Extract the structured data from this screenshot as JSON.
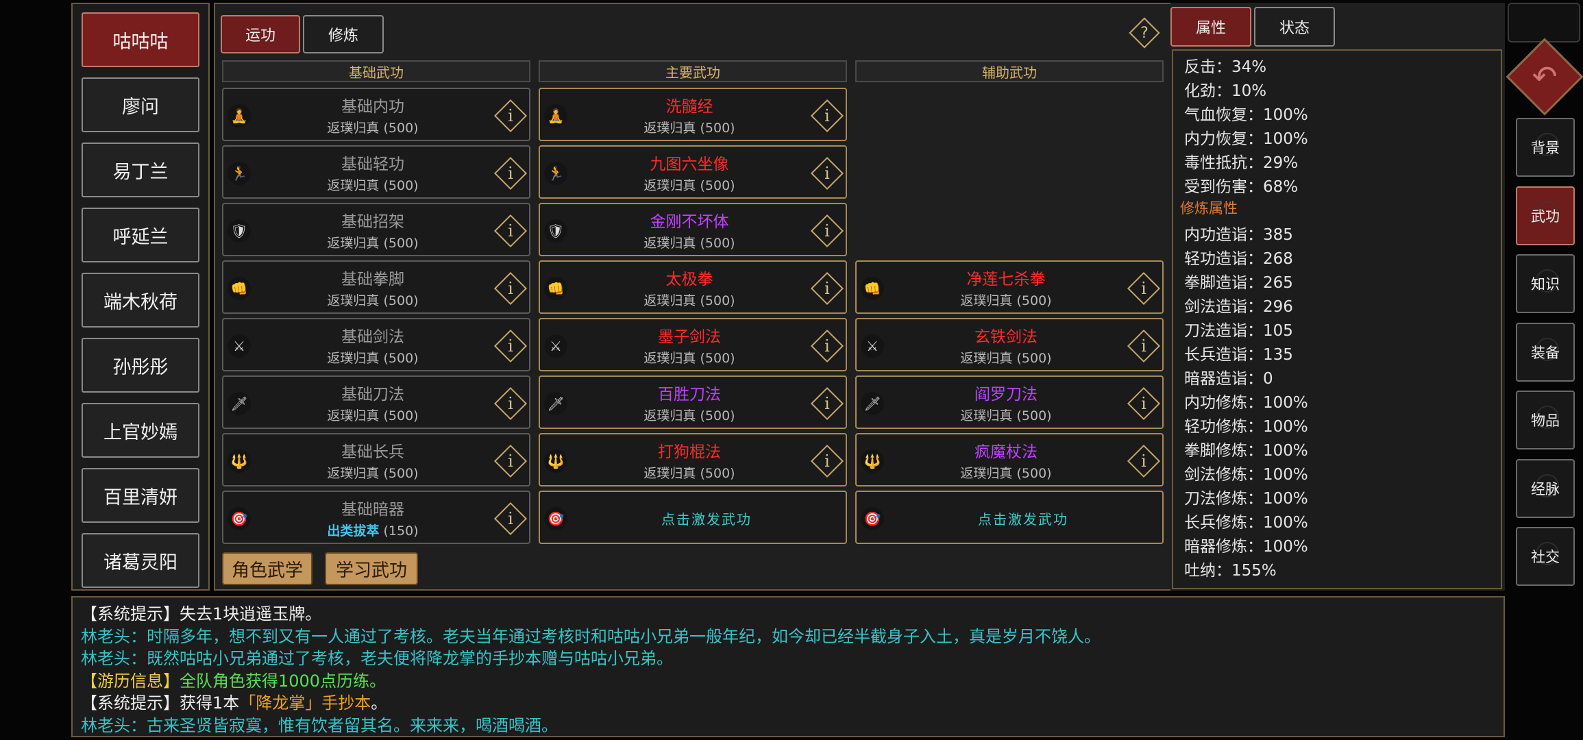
{
  "characters": [
    "咕咕咕",
    "廖问",
    "易丁兰",
    "呼延兰",
    "端木秋荷",
    "孙彤彤",
    "上官妙嫣",
    "百里清妍",
    "诸葛灵阳"
  ],
  "main_tabs": [
    "运功",
    "修炼"
  ],
  "help_label": "?",
  "columns": [
    "基础武功",
    "主要武功",
    "辅助武功"
  ],
  "basic_skills": [
    {
      "name": "基础内功",
      "level_label": "返璞归真",
      "level": "(500)",
      "icon": "🧘"
    },
    {
      "name": "基础轻功",
      "level_label": "返璞归真",
      "level": "(500)",
      "icon": "🏃"
    },
    {
      "name": "基础招架",
      "level_label": "返璞归真",
      "level": "(500)",
      "icon": "🛡"
    },
    {
      "name": "基础拳脚",
      "level_label": "返璞归真",
      "level": "(500)",
      "icon": "👊"
    },
    {
      "name": "基础剑法",
      "level_label": "返璞归真",
      "level": "(500)",
      "icon": "⚔"
    },
    {
      "name": "基础刀法",
      "level_label": "返璞归真",
      "level": "(500)",
      "icon": "🗡"
    },
    {
      "name": "基础长兵",
      "level_label": "返璞归真",
      "level": "(500)",
      "icon": "🔱"
    },
    {
      "name": "基础暗器",
      "level_label": "出类拔萃",
      "level": "(150)",
      "icon": "🎯"
    }
  ],
  "main_skills": [
    {
      "name": "洗髓经",
      "level_label": "返璞归真",
      "level": "(500)",
      "color": "#ff2a2a",
      "icon": "🧘"
    },
    {
      "name": "九图六坐像",
      "level_label": "返璞归真",
      "level": "(500)",
      "color": "#ff2a2a",
      "icon": "🏃"
    },
    {
      "name": "金刚不坏体",
      "level_label": "返璞归真",
      "level": "(500)",
      "color": "#c040ff",
      "icon": "🛡"
    },
    {
      "name": "太极拳",
      "level_label": "返璞归真",
      "level": "(500)",
      "color": "#ff2a2a",
      "icon": "👊"
    },
    {
      "name": "墨子剑法",
      "level_label": "返璞归真",
      "level": "(500)",
      "color": "#ff2a2a",
      "icon": "⚔"
    },
    {
      "name": "百胜刀法",
      "level_label": "返璞归真",
      "level": "(500)",
      "color": "#c040ff",
      "icon": "🗡"
    },
    {
      "name": "打狗棍法",
      "level_label": "返璞归真",
      "level": "(500)",
      "color": "#ff2a2a",
      "icon": "🔱"
    }
  ],
  "aux_skills": [
    {
      "name": "净莲七杀拳",
      "level_label": "返璞归真",
      "level": "(500)",
      "color": "#ff2a2a",
      "icon": "👊"
    },
    {
      "name": "玄铁剑法",
      "level_label": "返璞归真",
      "level": "(500)",
      "color": "#ff2a2a",
      "icon": "⚔"
    },
    {
      "name": "阎罗刀法",
      "level_label": "返璞归真",
      "level": "(500)",
      "color": "#c040ff",
      "icon": "🗡"
    },
    {
      "name": "疯魔杖法",
      "level_label": "返璞归真",
      "level": "(500)",
      "color": "#c040ff",
      "icon": "🔱"
    }
  ],
  "activate_label": "点击激发武功",
  "bottom_buttons": [
    "角色武学",
    "学习武功"
  ],
  "attr_tabs": [
    "属性",
    "状态"
  ],
  "attributes": [
    {
      "text": "反击：34%"
    },
    {
      "text": "化劲：10%"
    },
    {
      "text": "气血恢复：100%"
    },
    {
      "text": "内力恢复：100%"
    },
    {
      "text": "毒性抵抗：29%"
    },
    {
      "text": "受到伤害：68%"
    },
    {
      "text": "修炼属性",
      "section": true
    },
    {
      "text": "内功造诣：385"
    },
    {
      "text": "轻功造诣：268"
    },
    {
      "text": "拳脚造诣：265"
    },
    {
      "text": "剑法造诣：296"
    },
    {
      "text": "刀法造诣：105"
    },
    {
      "text": "长兵造诣：135"
    },
    {
      "text": "暗器造诣：0"
    },
    {
      "text": "内功修炼：100%"
    },
    {
      "text": "轻功修炼：100%"
    },
    {
      "text": "拳脚修炼：100%"
    },
    {
      "text": "剑法修炼：100%"
    },
    {
      "text": "刀法修炼：100%"
    },
    {
      "text": "长兵修炼：100%"
    },
    {
      "text": "暗器修炼：100%"
    },
    {
      "text": "吐纳：155%"
    }
  ],
  "back_icon": "↶",
  "nav_buttons": [
    "背景",
    "武功",
    "知识",
    "装备",
    "物品",
    "经脉",
    "社交"
  ],
  "active_nav": "武功",
  "log": [
    {
      "parts": [
        {
          "t": "【系统提示】失去1块逍遥玉牌。",
          "c": "c-white"
        }
      ]
    },
    {
      "parts": [
        {
          "t": "林老头：时隔多年，想不到又有一人通过了考核。老夫当年通过考核时和咕咕小兄弟一般年纪，如今却已经半截身子入土，真是岁月不饶人。",
          "c": "c-cyan"
        }
      ]
    },
    {
      "parts": [
        {
          "t": "林老头：既然咕咕小兄弟通过了考核，老夫便将降龙掌的手抄本赠与咕咕小兄弟。",
          "c": "c-cyan"
        }
      ]
    },
    {
      "parts": [
        {
          "t": "【游历信息】",
          "c": "c-yellow"
        },
        {
          "t": "全队角色获得1000点历练。",
          "c": "c-green"
        }
      ]
    },
    {
      "parts": [
        {
          "t": "【系统提示】获得1本",
          "c": "c-white"
        },
        {
          "t": "「降龙掌」手抄本",
          "c": "c-orange"
        },
        {
          "t": "。",
          "c": "c-white"
        }
      ]
    },
    {
      "parts": [
        {
          "t": "林老头：古来圣贤皆寂寞，惟有饮者留其名。来来来，喝酒喝酒。",
          "c": "c-cyan"
        }
      ]
    }
  ]
}
